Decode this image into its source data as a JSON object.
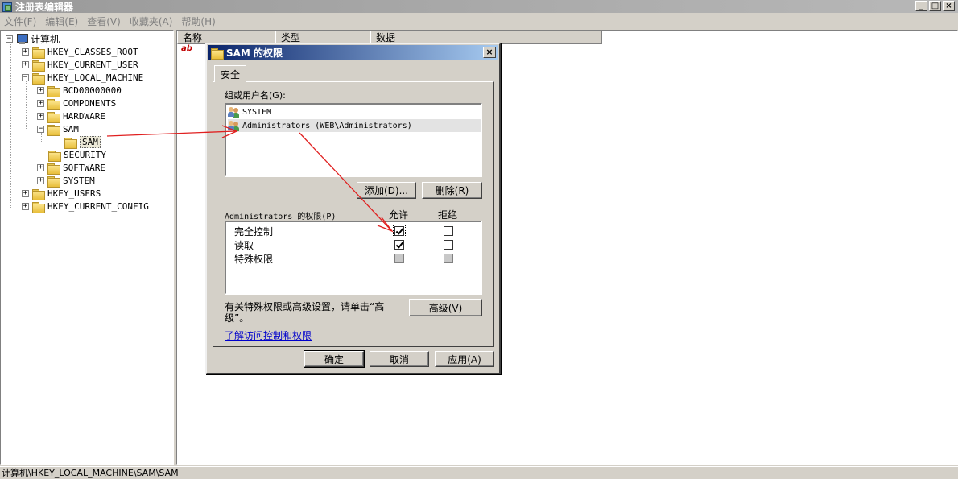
{
  "window": {
    "title": "注册表编辑器",
    "buttons": {
      "minimize": "_",
      "maximize": "□",
      "close": "×"
    }
  },
  "menu": [
    "文件(F)",
    "编辑(E)",
    "查看(V)",
    "收藏夹(A)",
    "帮助(H)"
  ],
  "tree": {
    "root": "计算机",
    "expanders": {
      "open": "−",
      "closed": "+"
    },
    "hives": {
      "classes_root": "HKEY_CLASSES_ROOT",
      "current_user": "HKEY_CURRENT_USER",
      "local_machine": "HKEY_LOCAL_MACHINE",
      "users": "HKEY_USERS",
      "current_config": "HKEY_CURRENT_CONFIG"
    },
    "local_machine_children": {
      "bcd": "BCD00000000",
      "components": "COMPONENTS",
      "hardware": "HARDWARE",
      "sam": "SAM",
      "sam_child": "SAM",
      "security": "SECURITY",
      "software": "SOFTWARE",
      "system": "SYSTEM"
    }
  },
  "list": {
    "columns": {
      "name": "名称",
      "type": "类型",
      "data": "数据"
    },
    "value_icon": "ab"
  },
  "status": "计算机\\HKEY_LOCAL_MACHINE\\SAM\\SAM",
  "dialog": {
    "title": "SAM 的权限",
    "close": "×",
    "tab": "安全",
    "group_label": "组或用户名(G):",
    "users": {
      "system": "SYSTEM",
      "admins": "Administrators (WEB\\Administrators)"
    },
    "add_button": "添加(D)...",
    "remove_button": "删除(R)",
    "perm_label": "Administrators 的权限(P)",
    "allow_header": "允许",
    "deny_header": "拒绝",
    "permissions": {
      "full": {
        "name": "完全控制",
        "allow": true,
        "deny": false
      },
      "read": {
        "name": "读取",
        "allow": true,
        "deny": false
      },
      "special": {
        "name": "特殊权限",
        "allow": false,
        "deny": false
      }
    },
    "advanced_hint_line1": "有关特殊权限或高级设置，请单击“高",
    "advanced_hint_line2": "级”。",
    "advanced_button": "高级(V)",
    "learn_link": "了解访问控制和权限",
    "ok": "确定",
    "cancel": "取消",
    "apply": "应用(A)"
  },
  "colors": {
    "annotation_arrow": "#e02020",
    "dialog_title_start": "#0a246a",
    "dialog_title_end": "#a6caf0"
  }
}
